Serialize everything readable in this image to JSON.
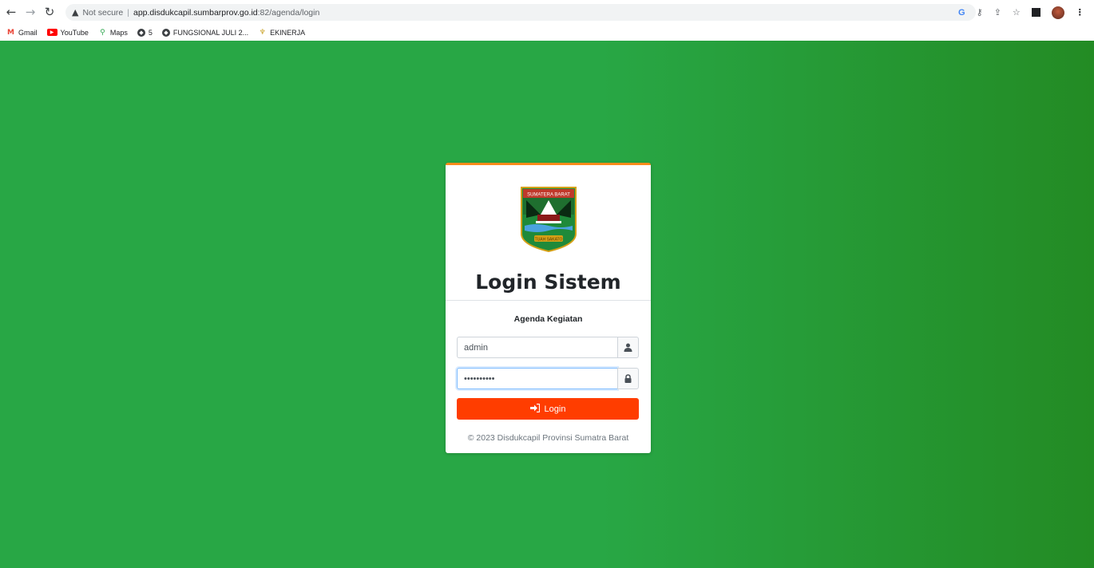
{
  "browser": {
    "not_secure_label": "Not secure",
    "url_host": "app.disdukcapil.sumbarprov.go.id",
    "url_path": ":82/agenda/login",
    "bookmarks": [
      {
        "label": "Gmail",
        "icon": "gmail-icon"
      },
      {
        "label": "YouTube",
        "icon": "youtube-icon"
      },
      {
        "label": "Maps",
        "icon": "maps-icon"
      },
      {
        "label": "5",
        "icon": "globe-icon"
      },
      {
        "label": "FUNGSIONAL JULI 2...",
        "icon": "globe-icon"
      },
      {
        "label": "EKINERJA",
        "icon": "garuda-icon"
      }
    ]
  },
  "login": {
    "emblem_text_top": "SUMATERA BARAT",
    "emblem_text_bottom": "TUAH SAKATO",
    "title": "Login Sistem",
    "subtitle": "Agenda Kegiatan",
    "username_value": "admin",
    "password_value": "••••••••••",
    "button_label": "Login",
    "footer": "© 2023 Disdukcapil Provinsi Sumatra Barat"
  },
  "colors": {
    "background": "#28a745",
    "card_accent": "#ff8c1a",
    "button": "#ff3d00"
  }
}
